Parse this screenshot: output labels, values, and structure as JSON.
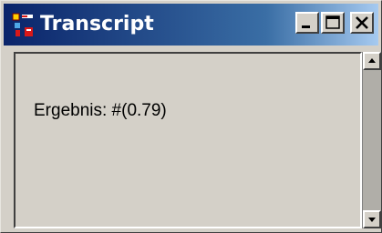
{
  "window": {
    "title": "Transcript",
    "icon": "transcript-app-icon",
    "title_buttons": [
      "minimize-icon",
      "maximize-icon",
      "close-icon"
    ]
  },
  "transcript": {
    "text": "Ergebnis: #(0.79)"
  },
  "scrollbar": {
    "up_icon": "arrow-up-icon",
    "down_icon": "arrow-down-icon"
  },
  "colors": {
    "title_gradient_start": "#0a246a",
    "title_gradient_end": "#a6caf0",
    "face": "#d4d0c8"
  }
}
